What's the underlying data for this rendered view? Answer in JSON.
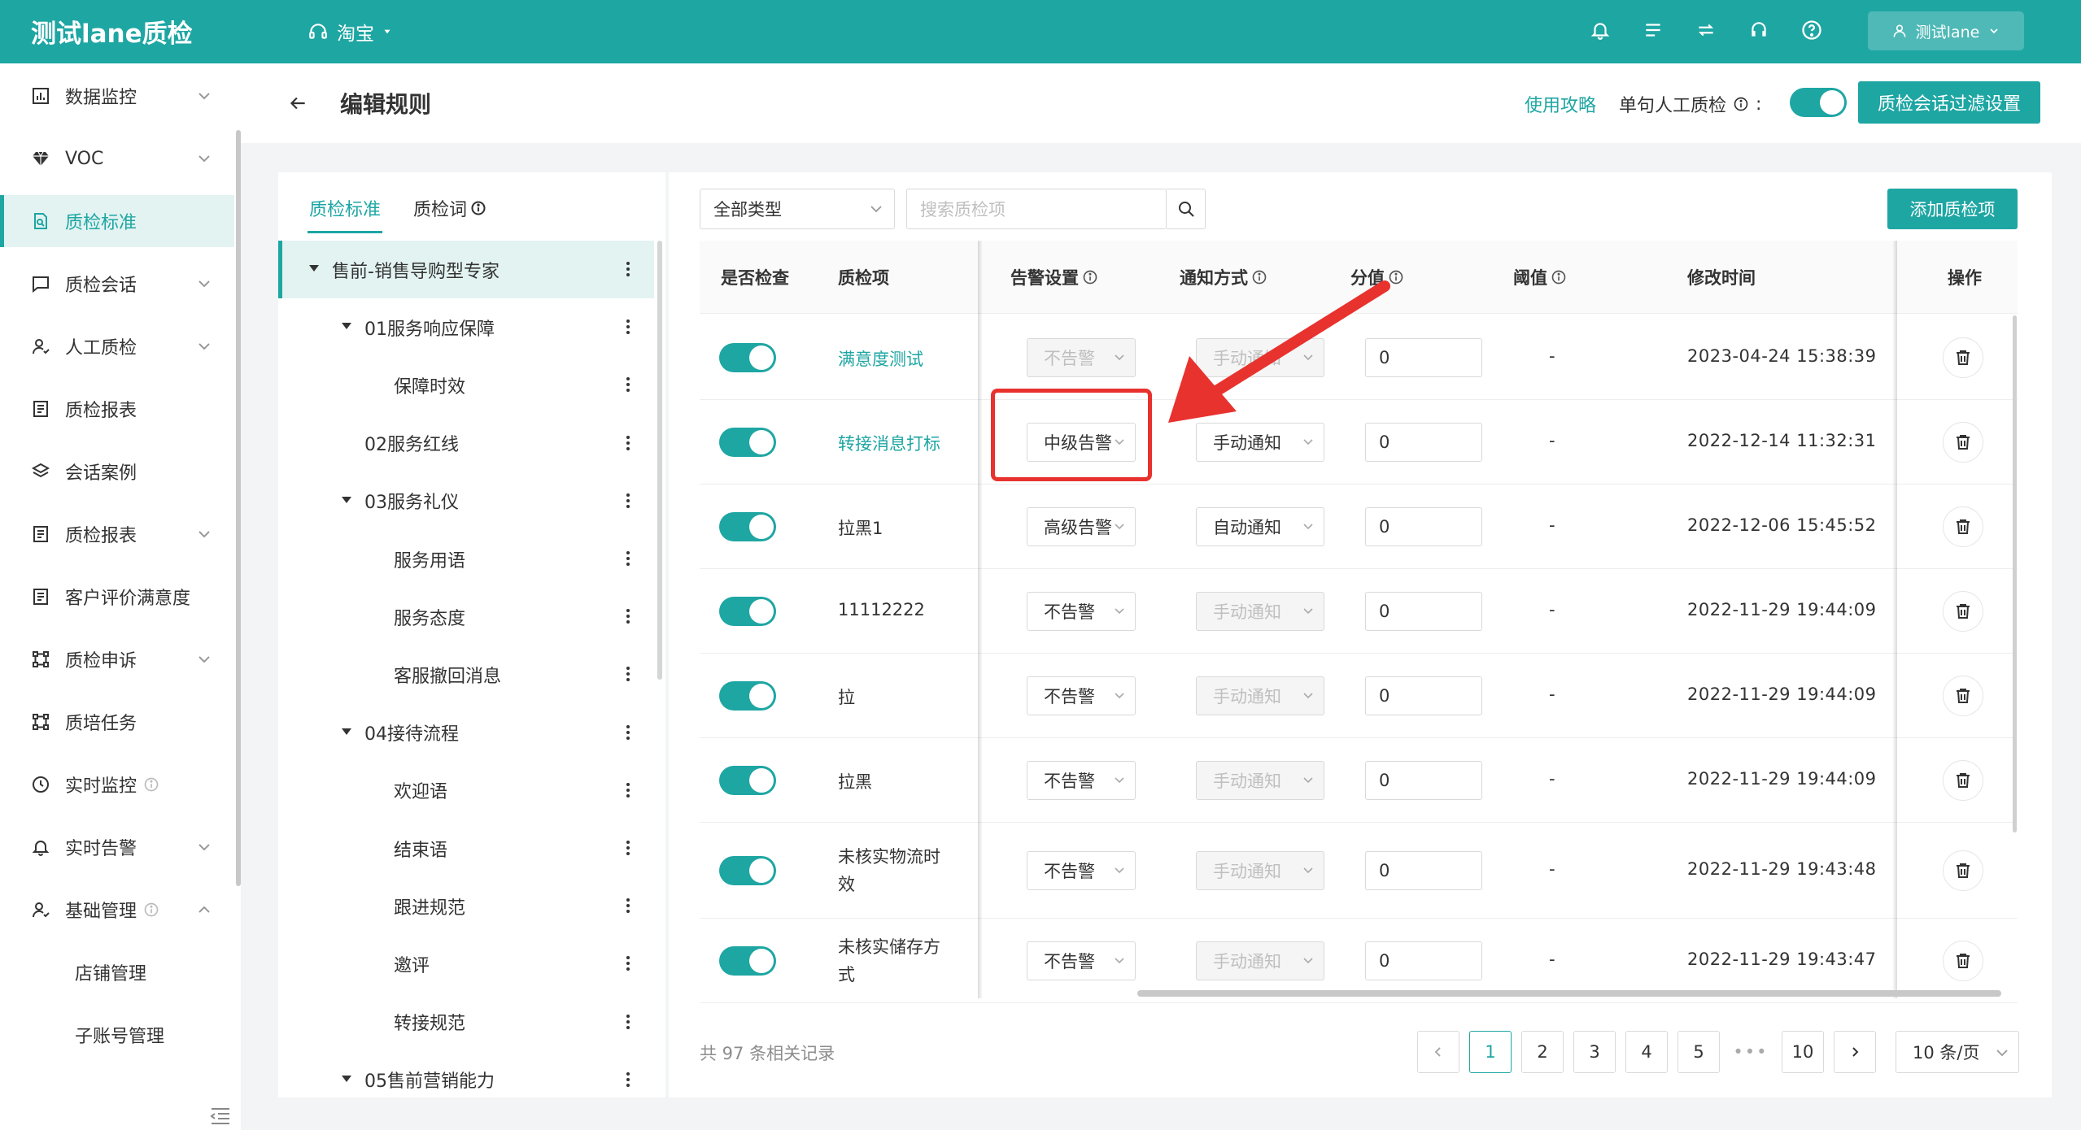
{
  "app": {
    "brand": "测试lane质检",
    "shop": "淘宝",
    "user": "测试lane"
  },
  "sidebar": {
    "items": [
      {
        "label": "数据监控",
        "icon": "chart-icon",
        "expandable": true
      },
      {
        "label": "VOC",
        "icon": "diamond-icon",
        "expandable": true
      },
      {
        "label": "质检标准",
        "icon": "doc-icon",
        "expandable": false,
        "active": true
      },
      {
        "label": "质检会话",
        "icon": "chat-icon",
        "expandable": true
      },
      {
        "label": "人工质检",
        "icon": "person-icon",
        "expandable": true
      },
      {
        "label": "质检报表",
        "icon": "report-icon",
        "expandable": false
      },
      {
        "label": "会话案例",
        "icon": "layers-icon",
        "expandable": false
      },
      {
        "label": "质检报表",
        "icon": "report-icon",
        "expandable": true
      },
      {
        "label": "客户评价满意度",
        "icon": "report-icon",
        "expandable": false
      },
      {
        "label": "质检申诉",
        "icon": "appeal-icon",
        "expandable": true
      },
      {
        "label": "质培任务",
        "icon": "task-icon",
        "expandable": false
      },
      {
        "label": "实时监控",
        "icon": "clock-icon",
        "expandable": false,
        "info": true
      },
      {
        "label": "实时告警",
        "icon": "bell-icon",
        "expandable": true
      },
      {
        "label": "基础管理",
        "icon": "person-icon",
        "expandable": true,
        "info": true,
        "open": true
      },
      {
        "label": "店铺管理",
        "sub": true
      },
      {
        "label": "子账号管理",
        "sub": true
      }
    ]
  },
  "header": {
    "title": "编辑规则",
    "guide": "使用攻略",
    "single_label": "单句人工质检",
    "single_colon": ":",
    "filter_button": "质检会话过滤设置"
  },
  "left": {
    "tabs": [
      "质检标准",
      "质检词"
    ],
    "tree": [
      {
        "label": "售前-销售导购型专家",
        "level": 0,
        "caret": true,
        "selected": true
      },
      {
        "label": "01服务响应保障",
        "level": 1,
        "caret": true
      },
      {
        "label": "保障时效",
        "level": 2
      },
      {
        "label": "02服务红线",
        "level": 1
      },
      {
        "label": "03服务礼仪",
        "level": 1,
        "caret": true
      },
      {
        "label": "服务用语",
        "level": 2
      },
      {
        "label": "服务态度",
        "level": 2
      },
      {
        "label": "客服撤回消息",
        "level": 2
      },
      {
        "label": "04接待流程",
        "level": 1,
        "caret": true
      },
      {
        "label": "欢迎语",
        "level": 2
      },
      {
        "label": "结束语",
        "level": 2
      },
      {
        "label": "跟进规范",
        "level": 2
      },
      {
        "label": "邀评",
        "level": 2
      },
      {
        "label": "转接规范",
        "level": 2
      },
      {
        "label": "05售前营销能力",
        "level": 1,
        "caret": true
      }
    ]
  },
  "toolbar": {
    "type_select": "全部类型",
    "search_placeholder": "搜索质检项",
    "add_button": "添加质检项"
  },
  "table": {
    "headers": {
      "check": "是否检查",
      "item": "质检项",
      "alert": "告警设置",
      "notify": "通知方式",
      "score": "分值",
      "threshold": "阈值",
      "time": "修改时间",
      "op": "操作"
    },
    "rows": [
      {
        "name": "满意度测试",
        "link": true,
        "alert": "不告警",
        "alert_disabled": true,
        "notify": "手动通知",
        "notify_disabled": true,
        "score": "0",
        "threshold": "-",
        "time": "2023-04-24 15:38:39"
      },
      {
        "name": "转接消息打标",
        "link": true,
        "alert": "中级告警",
        "alert_disabled": false,
        "notify": "手动通知",
        "notify_disabled": false,
        "score": "0",
        "threshold": "-",
        "time": "2022-12-14 11:32:31"
      },
      {
        "name": "拉黑1",
        "alert": "高级告警",
        "alert_disabled": false,
        "notify": "自动通知",
        "notify_disabled": false,
        "score": "0",
        "threshold": "-",
        "time": "2022-12-06 15:45:52"
      },
      {
        "name": "11112222",
        "alert": "不告警",
        "alert_disabled": false,
        "notify": "手动通知",
        "notify_disabled": true,
        "score": "0",
        "threshold": "-",
        "time": "2022-11-29 19:44:09"
      },
      {
        "name": "拉",
        "alert": "不告警",
        "alert_disabled": false,
        "notify": "手动通知",
        "notify_disabled": true,
        "score": "0",
        "threshold": "-",
        "time": "2022-11-29 19:44:09"
      },
      {
        "name": "拉黑",
        "alert": "不告警",
        "alert_disabled": false,
        "notify": "手动通知",
        "notify_disabled": true,
        "score": "0",
        "threshold": "-",
        "time": "2022-11-29 19:44:09"
      },
      {
        "name": "未核实物流时",
        "name2": "效",
        "alert": "不告警",
        "alert_disabled": false,
        "notify": "手动通知",
        "notify_disabled": true,
        "score": "0",
        "threshold": "-",
        "time": "2022-11-29 19:43:48"
      },
      {
        "name": "未核实储存方",
        "name2": "式",
        "alert": "不告警",
        "alert_disabled": false,
        "notify": "手动通知",
        "notify_disabled": true,
        "score": "0",
        "threshold": "-",
        "time": "2022-11-29 19:43:47"
      }
    ]
  },
  "pagination": {
    "total": "共 97 条相关记录",
    "pages": [
      "1",
      "2",
      "3",
      "4",
      "5",
      "•••",
      "10"
    ],
    "current": "1",
    "page_size": "10 条/页"
  },
  "colors": {
    "accent": "#1ea6a3",
    "highlight": "#e8322e"
  }
}
